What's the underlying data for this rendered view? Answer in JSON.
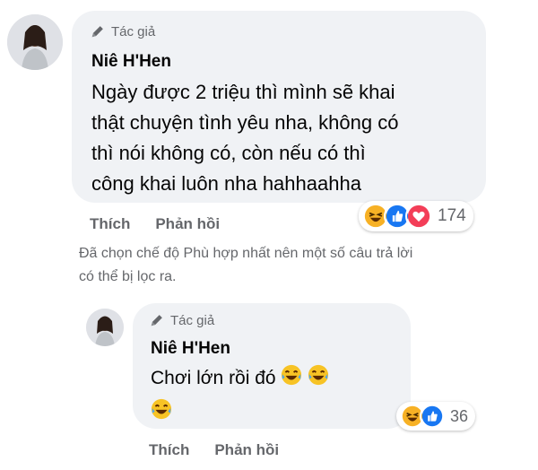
{
  "comment1": {
    "badge": "Tác giả",
    "author": "Niê H'Hen",
    "text_lines": [
      "Ngày được 2 triệu thì mình sẽ khai",
      "thật chuyện tình yêu nha, không có",
      "thì nói không có, còn nếu có thì",
      "công khai luôn nha hahhaahha"
    ],
    "actions": {
      "like": "Thích",
      "reply": "Phản hồi"
    },
    "reactions": {
      "icons": [
        "haha-icon",
        "like-icon",
        "love-icon"
      ],
      "count": "174"
    }
  },
  "filter_note": {
    "line1": "Đã chọn chế độ Phù hợp nhất nên một số câu trả lời",
    "line2": "có thể bị lọc ra."
  },
  "comment2": {
    "badge": "Tác giả",
    "author": "Niê H'Hen",
    "text": "Chơi lớn rồi đó",
    "actions": {
      "like": "Thích",
      "reply": "Phản hồi"
    },
    "reactions": {
      "icons": [
        "haha-icon",
        "like-icon"
      ],
      "count": "36"
    }
  },
  "colors": {
    "bubble_bg": "#f0f2f5",
    "secondary_text": "#65676b",
    "like_blue": "#1877f2",
    "love_red": "#f33e58",
    "haha_yellow": "#f7b125"
  }
}
